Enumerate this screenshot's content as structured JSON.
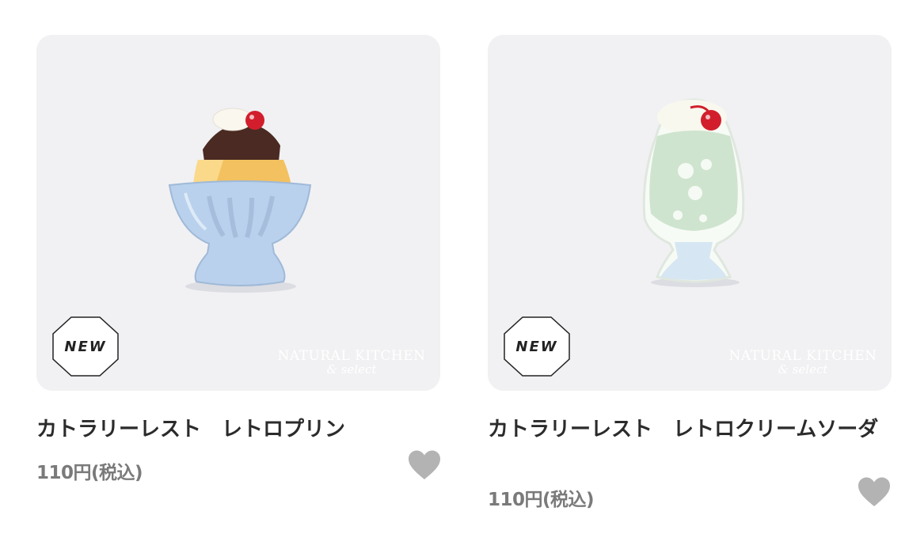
{
  "products": [
    {
      "badge": "NEW",
      "watermark": {
        "brand": "NATURAL KITCHEN",
        "sub": "& select"
      },
      "title": "カトラリーレスト　レトロプリン",
      "price": "110円(税込)",
      "favorite_icon": "heart-icon"
    },
    {
      "badge": "NEW",
      "watermark": {
        "brand": "NATURAL KITCHEN",
        "sub": "& select"
      },
      "title": "カトラリーレスト　レトロクリームソーダ",
      "price": "110円(税込)",
      "favorite_icon": "heart-icon"
    }
  ],
  "colors": {
    "heart": "#b3b3b3",
    "title": "#2b2b2b",
    "price": "#7a7a7a",
    "photo_bg": "#f1f1f3"
  }
}
